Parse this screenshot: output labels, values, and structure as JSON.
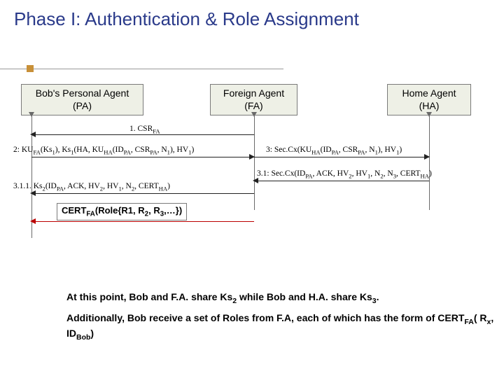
{
  "title": "Phase I: Authentication & Role Assignment",
  "agents": {
    "pa": {
      "line1": "Bob's Personal Agent",
      "line2": "(PA)"
    },
    "fa": {
      "line1": "Foreign Agent",
      "line2": "(FA)"
    },
    "ha": {
      "line1": "Home Agent",
      "line2": "(HA)"
    }
  },
  "msgs": {
    "m1": "1. CSR",
    "m1sub": "FA",
    "m2": "2: KU",
    "m2a": "(Ks",
    "m2b": "), Ks",
    "m2c": "(HA, KU",
    "m2d": "(ID",
    "m2e": ", CSR",
    "m2f": ", N",
    "m2g": "), HV",
    "m2h": ")",
    "m3": "3: Sec.Cx(KU",
    "m3a": "(ID",
    "m3b": ", CSR",
    "m3c": ", N",
    "m3d": "), HV",
    "m3e": ")",
    "m311": "3.1.1. Ks",
    "m311a": "(ID",
    "m311b": ", ACK, HV",
    "m311c": ", HV",
    "m311d": ", N",
    "m311e": ", CERT",
    "m311f": ")",
    "m31": "3.1: Sec.Cx(ID",
    "m31a": ", ACK, HV",
    "m31b": ", HV",
    "m31c": ", N",
    "m31d": ", N",
    "m31e": ", CERT",
    "m31f": ")",
    "cert_pre": "CERT",
    "cert_sub": "FA",
    "cert_post": "(Role{R1, R",
    "cert_sub2": "2",
    "cert_post2": ", R",
    "cert_sub3": "3",
    "cert_post3": ",…})",
    "sub_PA": "PA",
    "sub_FA": "FA",
    "sub_HA": "HA",
    "sub_1": "1",
    "sub_2": "2",
    "sub_3": "3"
  },
  "footer": {
    "p1a": "At this point, Bob and F.A. share Ks",
    "p1b": " while Bob and H.A. share Ks",
    "p1c": ".",
    "p1sub1": "2",
    "p1sub2": "3",
    "p2a": "Additionally, Bob receive a set of Roles from F.A, each of which has the form of CERT",
    "p2b": "( R",
    "p2c": ", ID",
    "p2d": ")",
    "p2sub1": "FA",
    "p2sub2": "x",
    "p2sub3": "Bob"
  }
}
